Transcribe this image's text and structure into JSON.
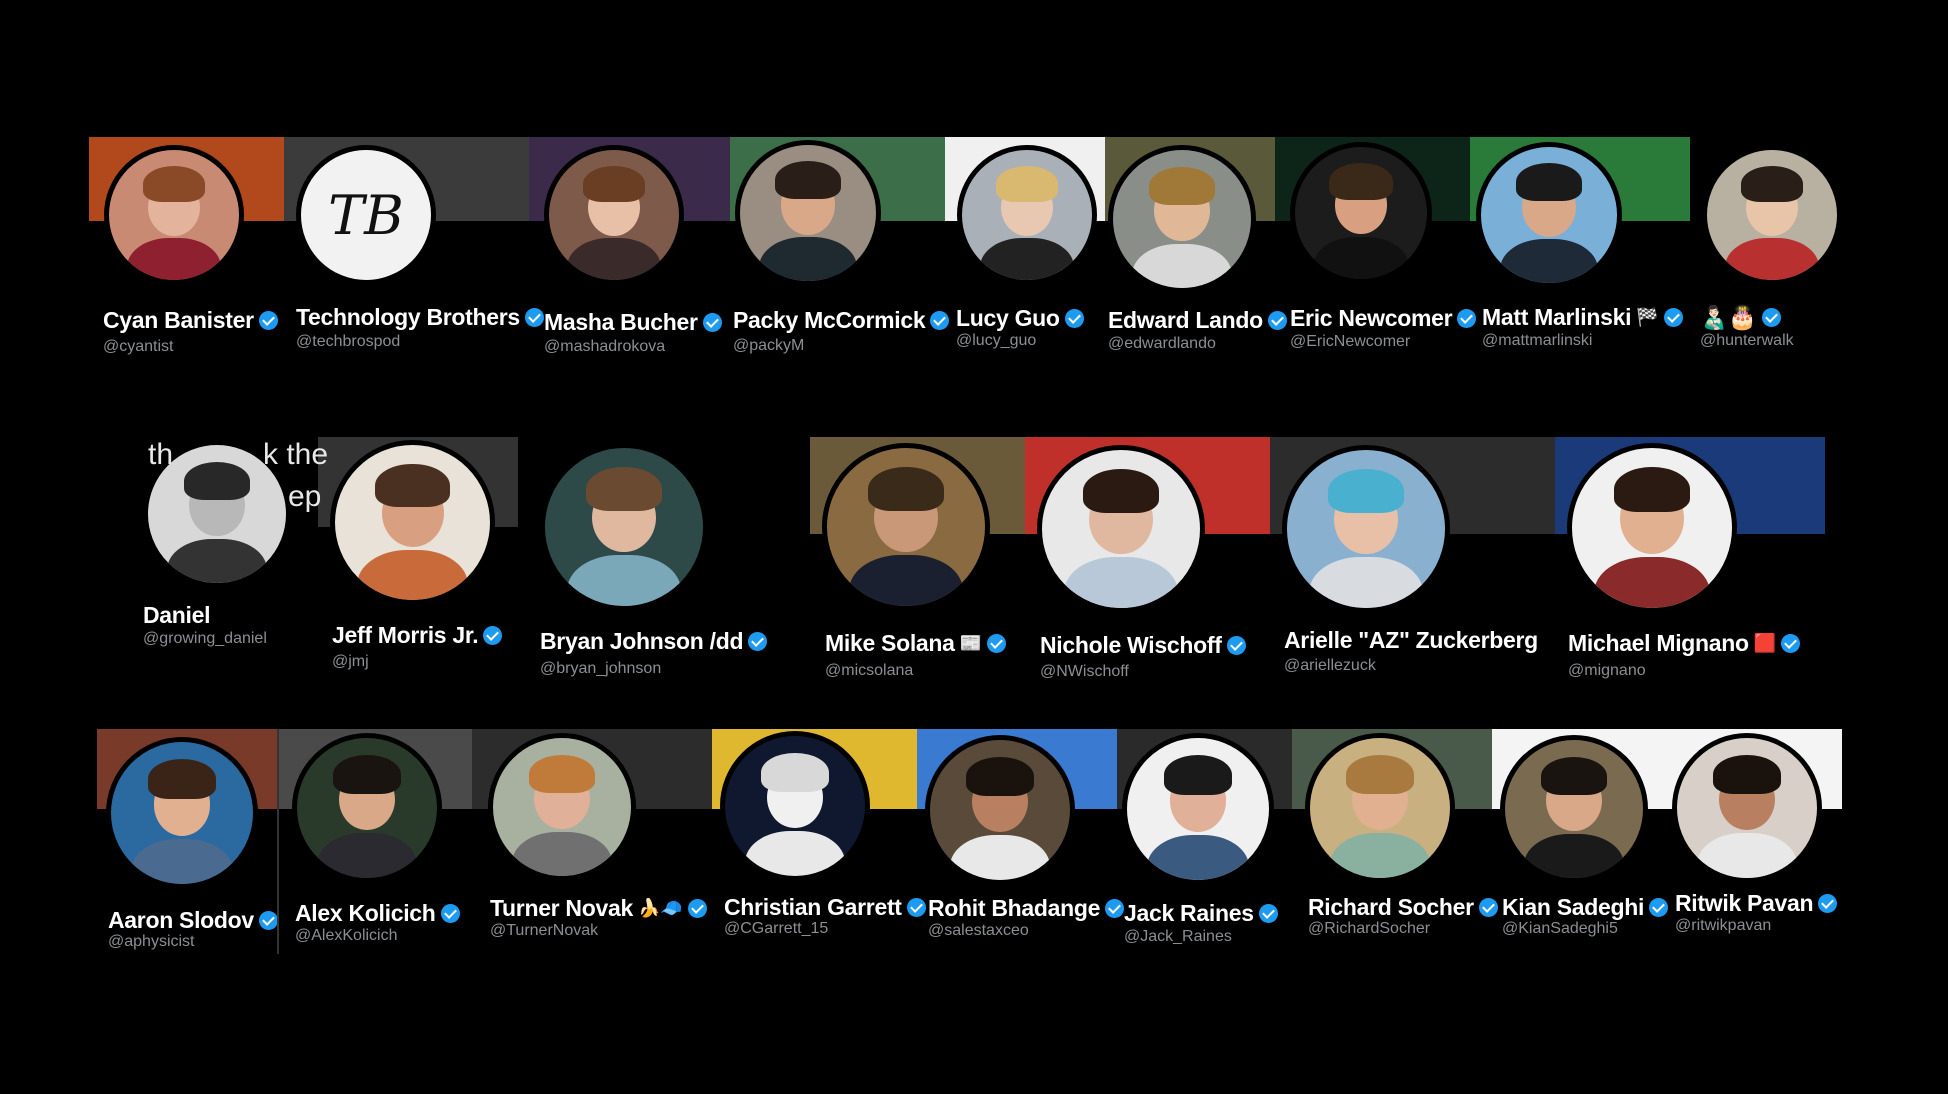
{
  "rows": [
    [
      {
        "name": "Cyan Banister",
        "handle": "@cyantist",
        "verified": true,
        "extra": "",
        "banner_color": "#b2491c",
        "avatar_bg": "#c98a74",
        "face": "#e3b39b",
        "hair": "#8a4a28",
        "shirt": "#8e2030",
        "avatar_name": "avatar-cyan-banister"
      },
      {
        "name": "Technology Brothers",
        "handle": "@techbrospod",
        "verified": true,
        "extra": "",
        "banner_color": "#3b3b3b",
        "avatar_bg": "#f2f2f2",
        "monogram": "TB",
        "avatar_name": "avatar-technology-brothers"
      },
      {
        "name": "Masha Bucher",
        "handle": "@mashadrokova",
        "verified": true,
        "extra": "",
        "banner_color": "#3b2a4a",
        "avatar_bg": "#7d5a4a",
        "face": "#e8c0a8",
        "hair": "#6a3e22",
        "shirt": "#3a2a2a",
        "avatar_name": "avatar-masha-bucher"
      },
      {
        "name": "Packy McCormick",
        "handle": "@packyM",
        "verified": true,
        "extra": "",
        "banner_color": "#3d6e4a",
        "avatar_bg": "#9a8e82",
        "face": "#d8a888",
        "hair": "#2a1e18",
        "shirt": "#1e2a30",
        "avatar_name": "avatar-packy-mccormick"
      },
      {
        "name": "Lucy Guo",
        "handle": "@lucy_guo",
        "verified": true,
        "extra": "",
        "banner_color": "#f0f0f0",
        "avatar_bg": "#a9b0b8",
        "face": "#e8c8b0",
        "hair": "#d9b870",
        "shirt": "#222222",
        "avatar_name": "avatar-lucy-guo"
      },
      {
        "name": "Edward Lando",
        "handle": "@edwardlando",
        "verified": true,
        "extra": "",
        "banner_color": "#5a5a3a",
        "avatar_bg": "#8a8e88",
        "face": "#e0b898",
        "hair": "#a07838",
        "shirt": "#d8d8d8",
        "avatar_name": "avatar-edward-lando"
      },
      {
        "name": "Eric Newcomer",
        "handle": "@EricNewcomer",
        "verified": true,
        "extra": "",
        "banner_color": "#0d2418",
        "avatar_bg": "#1c1c1c",
        "face": "#d8a080",
        "hair": "#3a2818",
        "shirt": "#111111",
        "avatar_name": "avatar-eric-newcomer"
      },
      {
        "name": "Matt Marlinski",
        "handle": "@mattmarlinski",
        "verified": true,
        "extra": "🏁",
        "banner_color": "#2a7a3a",
        "avatar_bg": "#7ab0d8",
        "face": "#d8a888",
        "hair": "#1a1a1a",
        "shirt": "#1e2a38",
        "avatar_name": "avatar-matt-marlinski"
      },
      {
        "name": "👨🏻‍🍼🎂",
        "handle": "@hunterwalk",
        "verified": true,
        "extra": "",
        "banner_color": "#000000",
        "avatar_bg": "#b8b0a0",
        "face": "#e8c4a8",
        "hair": "#2a1e18",
        "shirt": "#b83030",
        "avatar_name": "avatar-hunterwalk"
      }
    ],
    [
      {
        "name": "Daniel",
        "handle": "@growing_daniel",
        "verified": false,
        "extra": "",
        "banner_color": "#000000",
        "avatar_bg": "#d8d8d8",
        "face": "#b8b8b8",
        "hair": "#282828",
        "shirt": "#333333",
        "avatar_name": "avatar-daniel"
      },
      {
        "name": "Jeff Morris Jr.",
        "handle": "@jmj",
        "verified": true,
        "extra": "",
        "banner_color": "#333333",
        "avatar_bg": "#e8e2d8",
        "face": "#d8a080",
        "hair": "#4a3020",
        "shirt": "#c86a3a",
        "avatar_name": "avatar-jeff-morris"
      },
      {
        "name": "Bryan Johnson /dd",
        "handle": "@bryan_johnson",
        "verified": true,
        "extra": "",
        "banner_color": "#000000",
        "avatar_bg": "#2e4a48",
        "face": "#e0b8a0",
        "hair": "#6a4a30",
        "shirt": "#7aa8b8",
        "avatar_name": "avatar-bryan-johnson"
      },
      {
        "name": "Mike Solana",
        "handle": "@micsolana",
        "verified": true,
        "extra": "📰",
        "banner_color": "#6a5a3a",
        "avatar_bg": "#8a6a40",
        "face": "#c89878",
        "hair": "#3a2a1a",
        "shirt": "#1a2030",
        "avatar_name": "avatar-mike-solana"
      },
      {
        "name": "Nichole Wischoff",
        "handle": "@NWischoff",
        "verified": true,
        "extra": "",
        "banner_color": "#c0302a",
        "avatar_bg": "#e8e8e8",
        "face": "#e0b8a0",
        "hair": "#2a1a12",
        "shirt": "#b8c8d8",
        "avatar_name": "avatar-nichole-wischoff"
      },
      {
        "name": "Arielle \"AZ\" Zuckerberg",
        "handle": "@ariellezuck",
        "verified": false,
        "extra": "",
        "banner_color": "#2c2c2c",
        "avatar_bg": "#8ab0d0",
        "face": "#e8c0a8",
        "hair": "#4ab0d0",
        "shirt": "#d8dce0",
        "avatar_name": "avatar-arielle-zuckerberg"
      },
      {
        "name": "Michael Mignano",
        "handle": "@mignano",
        "verified": true,
        "extra": "🟥",
        "banner_color": "#1a3a7a",
        "avatar_bg": "#f0f0f0",
        "face": "#e0b090",
        "hair": "#2a1a12",
        "shirt": "#8a2a2a",
        "avatar_name": "avatar-michael-mignano"
      }
    ],
    [
      {
        "name": "Aaron Slodov",
        "handle": "@aphysicist",
        "verified": true,
        "extra": "",
        "banner_color": "#7a3a2a",
        "avatar_bg": "#2a6aa0",
        "face": "#e0b090",
        "hair": "#3a2418",
        "shirt": "#4a6a90",
        "avatar_name": "avatar-aaron-slodov"
      },
      {
        "name": "Alex Kolicich",
        "handle": "@AlexKolicich",
        "verified": true,
        "extra": "",
        "banner_color": "#4a4a4a",
        "avatar_bg": "#2a3a2a",
        "face": "#d8a888",
        "hair": "#1a1410",
        "shirt": "#2a2a30",
        "avatar_name": "avatar-alex-kolicich"
      },
      {
        "name": "Turner Novak",
        "handle": "@TurnerNovak",
        "verified": true,
        "extra": "🍌🧢",
        "banner_color": "#2c2c2c",
        "avatar_bg": "#a8b0a0",
        "face": "#e0b098",
        "hair": "#c07a3a",
        "shirt": "#707070",
        "avatar_name": "avatar-turner-novak"
      },
      {
        "name": "Christian Garrett",
        "handle": "@CGarrett_15",
        "verified": true,
        "extra": "",
        "banner_color": "#e0b830",
        "avatar_bg": "#101830",
        "face": "#f0f0f0",
        "hair": "#d8d8d8",
        "shirt": "#e8e8e8",
        "avatar_name": "avatar-christian-garrett"
      },
      {
        "name": "Rohit Bhadange",
        "handle": "@salestaxceo",
        "verified": true,
        "extra": "",
        "banner_color": "#3a7ad0",
        "avatar_bg": "#5a4a3a",
        "face": "#b88060",
        "hair": "#1a120c",
        "shirt": "#e8e8e8",
        "avatar_name": "avatar-rohit-bhadange"
      },
      {
        "name": "Jack Raines",
        "handle": "@Jack_Raines",
        "verified": true,
        "extra": "",
        "banner_color": "#2a2a2a",
        "avatar_bg": "#f0f0f0",
        "face": "#e0b098",
        "hair": "#1a1a1a",
        "shirt": "#3a5a80",
        "avatar_name": "avatar-jack-raines"
      },
      {
        "name": "Richard Socher",
        "handle": "@RichardSocher",
        "verified": true,
        "extra": "",
        "banner_color": "#4a5a4a",
        "avatar_bg": "#c8b080",
        "face": "#e0b090",
        "hair": "#a87a40",
        "shirt": "#8ab0a0",
        "avatar_name": "avatar-richard-socher"
      },
      {
        "name": "Kian Sadeghi",
        "handle": "@KianSadeghi5",
        "verified": true,
        "extra": "",
        "banner_color": "#f4f4f4",
        "avatar_bg": "#7a6a50",
        "face": "#d8a888",
        "hair": "#1a1410",
        "shirt": "#1a1a1a",
        "avatar_name": "avatar-kian-sadeghi"
      },
      {
        "name": "Ritwik Pavan",
        "handle": "@ritwikpavan",
        "verified": true,
        "extra": "",
        "banner_color": "#f4f4f4",
        "avatar_bg": "#d8d0c8",
        "face": "#b88060",
        "hair": "#1a120c",
        "shirt": "#e8e8e8",
        "avatar_name": "avatar-ritwik-pavan"
      }
    ]
  ],
  "tweet_fragment": {
    "line1": "th",
    "line1b": "k the",
    "line2": "ep"
  }
}
